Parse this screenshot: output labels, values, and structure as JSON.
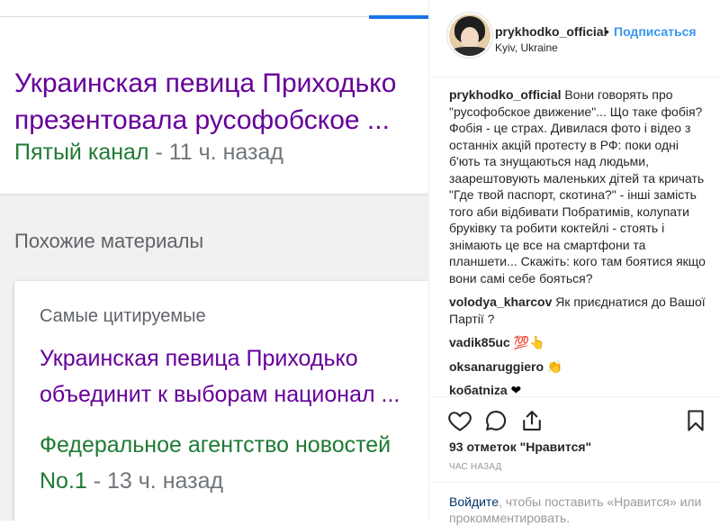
{
  "left": {
    "top_result": {
      "headline_line1": "Украинская певица Приходько",
      "headline_line2": "презентовала русофобское ...",
      "source": "Пятый канал",
      "time": " - 11 ч. назад"
    },
    "related_section_title": "Похожие материалы",
    "related_card": {
      "label": "Самые цитируемые",
      "headline_line1": "Украинская певица Приходько",
      "headline_line2": "объединит к выборам национал ...",
      "source_line1": "Федеральное агентство новостей",
      "source_line2": "No.1",
      "time": " - 13 ч. назад"
    }
  },
  "instagram": {
    "username": "prykhodko_official",
    "dot": "•",
    "follow_label": "Подписаться",
    "location": "Kyiv, Ukraine",
    "comments": [
      {
        "user": "prykhodko_official",
        "text": " Вони говорять про \"русофобское движение\"... Що таке фобія? Фобія - це страх. Дивилася фото і відео з останніх акцій протесту в РФ: поки одні б'ють та знущаються над людьми, заарештовують маленьких дітей та кричать \"Где твой паспорт, скотина?\" - інші замість того аби відбивати Побратимів, колупати бруківку та робити коктейлі - стоять і знімають це все на смартфони та планшети... Скажіть: кого там боятися якщо вони самі себе бояться?"
      },
      {
        "user": "volodya_kharcov",
        "text": " Як приєднатися до Вашої Партії ?"
      },
      {
        "user": "vadik85uc",
        "text": " 💯👆"
      },
      {
        "user": "oksanaruggiero",
        "text": " 👏"
      },
      {
        "user": "kобatniza",
        "text": " ❤"
      }
    ],
    "likes": "93 отметок \"Нравится\"",
    "time": "ЧАС НАЗАД",
    "login_link": "Войдите",
    "login_text": ", чтобы поставить «Нравится» или прокомментировать."
  },
  "colors": {
    "headline": "#660099",
    "source_green": "#1e7a34",
    "instagram_blue": "#3897f0",
    "tab_blue": "#1a73e8"
  }
}
